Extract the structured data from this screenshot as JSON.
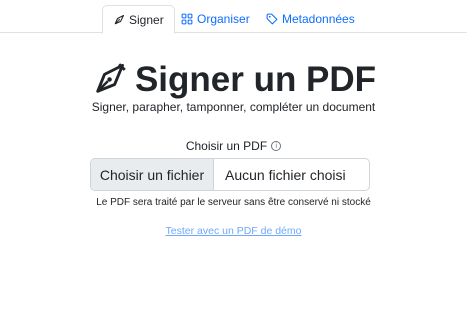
{
  "tabs": [
    {
      "label": "Signer",
      "icon": "pen-nib-icon",
      "active": true
    },
    {
      "label": "Organiser",
      "icon": "grid-icon",
      "active": false
    },
    {
      "label": "Metadonnées",
      "icon": "tag-icon",
      "active": false
    }
  ],
  "header": {
    "title": "Signer un PDF",
    "subtitle": "Signer, parapher, tamponner, compléter un document"
  },
  "upload": {
    "label": "Choisir un PDF",
    "button_label": "Choisir un fichier",
    "file_name": "Aucun fichier choisi",
    "hint": "Le PDF sera traité par le serveur sans être conservé ni stocké"
  },
  "demo_link": "Tester avec un PDF de démo",
  "colors": {
    "link": "#0d6efd",
    "demo_link": "#6ea8fe",
    "text": "#212529",
    "border": "#dee2e6",
    "file_button_bg": "#e9ecef"
  }
}
